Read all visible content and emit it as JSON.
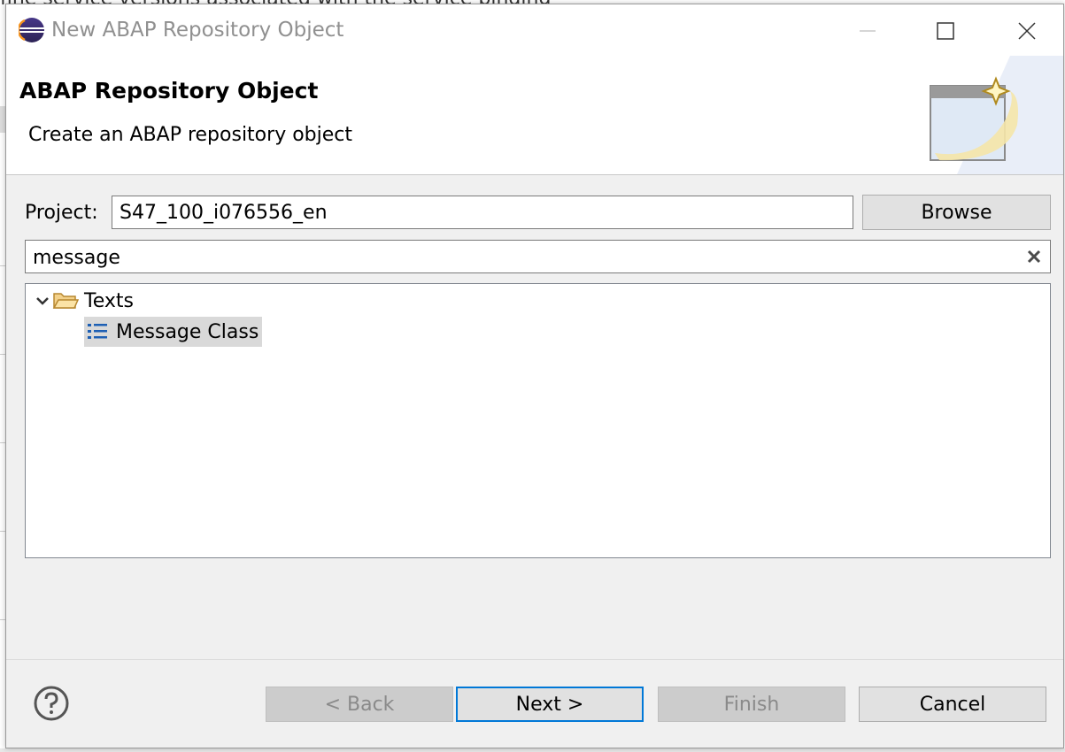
{
  "background": {
    "text": "fine service versions associated with the service binding"
  },
  "window": {
    "title": "New ABAP Repository Object",
    "icon": "eclipse-icon",
    "controls": [
      "minimize-icon",
      "maximize-icon",
      "close-icon"
    ]
  },
  "header": {
    "title": "ABAP Repository Object",
    "description": "Create an ABAP repository object",
    "image": "new-object-wizard-icon"
  },
  "project": {
    "label": "Project:",
    "value": "S47_100_i076556_en",
    "browse_label": "Browse"
  },
  "filter": {
    "value": "message",
    "clear_icon": "clear-icon"
  },
  "tree": {
    "items": [
      {
        "label": "Texts",
        "icon": "open-folder-icon",
        "expanded": true
      },
      {
        "label": "Message Class",
        "icon": "list-icon",
        "selected": true
      }
    ]
  },
  "footer": {
    "help_icon": "help-icon",
    "back_label": "< Back",
    "next_label": "Next >",
    "finish_label": "Finish",
    "cancel_label": "Cancel"
  },
  "colors": {
    "accent": "#0078d7",
    "dialog_bg": "#f0f0f0",
    "selection": "#d9d9d9",
    "disabled_text": "#8a8a8a"
  }
}
